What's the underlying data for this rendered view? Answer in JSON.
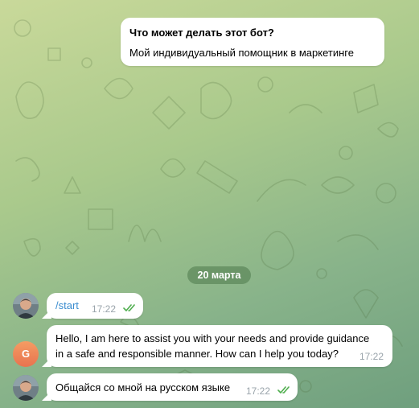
{
  "bot_info": {
    "title": "Что может делать этот бот?",
    "description": "Мой индивидуальный помощник в маркетинге"
  },
  "date_separator": "20 марта",
  "messages": [
    {
      "sender": "user",
      "avatar": "user-photo",
      "text": "/start",
      "time": "17:22",
      "status": "read",
      "status_icon": "double-check-icon"
    },
    {
      "sender": "bot",
      "avatar_letter": "G",
      "lines": [
        "Hello, I am here to assist you with your needs and provide guidance",
        "in a safe and responsible manner. How can I help you today?"
      ],
      "time": "17:22"
    },
    {
      "sender": "user",
      "avatar": "user-photo",
      "text": "Общайся со мной на русском языке",
      "time": "17:22",
      "status": "read",
      "status_icon": "double-check-icon"
    }
  ],
  "colors": {
    "read_check": "#4fae4e",
    "command_link": "#3a8ccf",
    "bot_avatar": "#e8734f",
    "date_badge": "#4c784a"
  }
}
